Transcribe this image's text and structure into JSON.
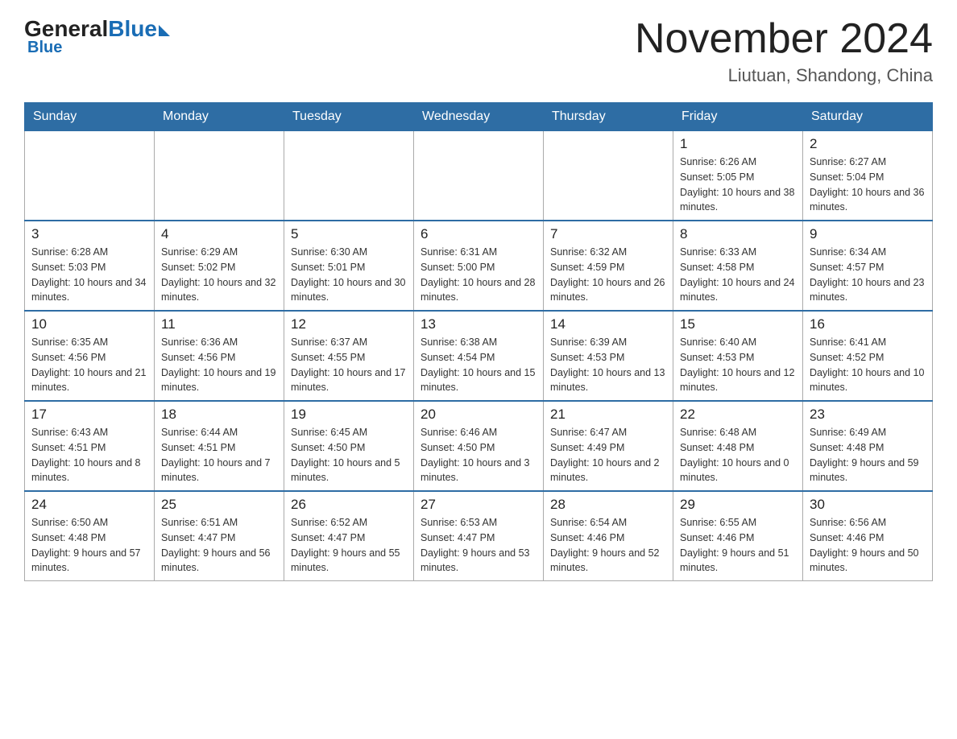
{
  "header": {
    "logo_general": "General",
    "logo_blue": "Blue",
    "main_title": "November 2024",
    "subtitle": "Liutuan, Shandong, China"
  },
  "weekdays": [
    "Sunday",
    "Monday",
    "Tuesday",
    "Wednesday",
    "Thursday",
    "Friday",
    "Saturday"
  ],
  "weeks": [
    [
      {
        "day": "",
        "info": ""
      },
      {
        "day": "",
        "info": ""
      },
      {
        "day": "",
        "info": ""
      },
      {
        "day": "",
        "info": ""
      },
      {
        "day": "",
        "info": ""
      },
      {
        "day": "1",
        "info": "Sunrise: 6:26 AM\nSunset: 5:05 PM\nDaylight: 10 hours and 38 minutes."
      },
      {
        "day": "2",
        "info": "Sunrise: 6:27 AM\nSunset: 5:04 PM\nDaylight: 10 hours and 36 minutes."
      }
    ],
    [
      {
        "day": "3",
        "info": "Sunrise: 6:28 AM\nSunset: 5:03 PM\nDaylight: 10 hours and 34 minutes."
      },
      {
        "day": "4",
        "info": "Sunrise: 6:29 AM\nSunset: 5:02 PM\nDaylight: 10 hours and 32 minutes."
      },
      {
        "day": "5",
        "info": "Sunrise: 6:30 AM\nSunset: 5:01 PM\nDaylight: 10 hours and 30 minutes."
      },
      {
        "day": "6",
        "info": "Sunrise: 6:31 AM\nSunset: 5:00 PM\nDaylight: 10 hours and 28 minutes."
      },
      {
        "day": "7",
        "info": "Sunrise: 6:32 AM\nSunset: 4:59 PM\nDaylight: 10 hours and 26 minutes."
      },
      {
        "day": "8",
        "info": "Sunrise: 6:33 AM\nSunset: 4:58 PM\nDaylight: 10 hours and 24 minutes."
      },
      {
        "day": "9",
        "info": "Sunrise: 6:34 AM\nSunset: 4:57 PM\nDaylight: 10 hours and 23 minutes."
      }
    ],
    [
      {
        "day": "10",
        "info": "Sunrise: 6:35 AM\nSunset: 4:56 PM\nDaylight: 10 hours and 21 minutes."
      },
      {
        "day": "11",
        "info": "Sunrise: 6:36 AM\nSunset: 4:56 PM\nDaylight: 10 hours and 19 minutes."
      },
      {
        "day": "12",
        "info": "Sunrise: 6:37 AM\nSunset: 4:55 PM\nDaylight: 10 hours and 17 minutes."
      },
      {
        "day": "13",
        "info": "Sunrise: 6:38 AM\nSunset: 4:54 PM\nDaylight: 10 hours and 15 minutes."
      },
      {
        "day": "14",
        "info": "Sunrise: 6:39 AM\nSunset: 4:53 PM\nDaylight: 10 hours and 13 minutes."
      },
      {
        "day": "15",
        "info": "Sunrise: 6:40 AM\nSunset: 4:53 PM\nDaylight: 10 hours and 12 minutes."
      },
      {
        "day": "16",
        "info": "Sunrise: 6:41 AM\nSunset: 4:52 PM\nDaylight: 10 hours and 10 minutes."
      }
    ],
    [
      {
        "day": "17",
        "info": "Sunrise: 6:43 AM\nSunset: 4:51 PM\nDaylight: 10 hours and 8 minutes."
      },
      {
        "day": "18",
        "info": "Sunrise: 6:44 AM\nSunset: 4:51 PM\nDaylight: 10 hours and 7 minutes."
      },
      {
        "day": "19",
        "info": "Sunrise: 6:45 AM\nSunset: 4:50 PM\nDaylight: 10 hours and 5 minutes."
      },
      {
        "day": "20",
        "info": "Sunrise: 6:46 AM\nSunset: 4:50 PM\nDaylight: 10 hours and 3 minutes."
      },
      {
        "day": "21",
        "info": "Sunrise: 6:47 AM\nSunset: 4:49 PM\nDaylight: 10 hours and 2 minutes."
      },
      {
        "day": "22",
        "info": "Sunrise: 6:48 AM\nSunset: 4:48 PM\nDaylight: 10 hours and 0 minutes."
      },
      {
        "day": "23",
        "info": "Sunrise: 6:49 AM\nSunset: 4:48 PM\nDaylight: 9 hours and 59 minutes."
      }
    ],
    [
      {
        "day": "24",
        "info": "Sunrise: 6:50 AM\nSunset: 4:48 PM\nDaylight: 9 hours and 57 minutes."
      },
      {
        "day": "25",
        "info": "Sunrise: 6:51 AM\nSunset: 4:47 PM\nDaylight: 9 hours and 56 minutes."
      },
      {
        "day": "26",
        "info": "Sunrise: 6:52 AM\nSunset: 4:47 PM\nDaylight: 9 hours and 55 minutes."
      },
      {
        "day": "27",
        "info": "Sunrise: 6:53 AM\nSunset: 4:47 PM\nDaylight: 9 hours and 53 minutes."
      },
      {
        "day": "28",
        "info": "Sunrise: 6:54 AM\nSunset: 4:46 PM\nDaylight: 9 hours and 52 minutes."
      },
      {
        "day": "29",
        "info": "Sunrise: 6:55 AM\nSunset: 4:46 PM\nDaylight: 9 hours and 51 minutes."
      },
      {
        "day": "30",
        "info": "Sunrise: 6:56 AM\nSunset: 4:46 PM\nDaylight: 9 hours and 50 minutes."
      }
    ]
  ]
}
